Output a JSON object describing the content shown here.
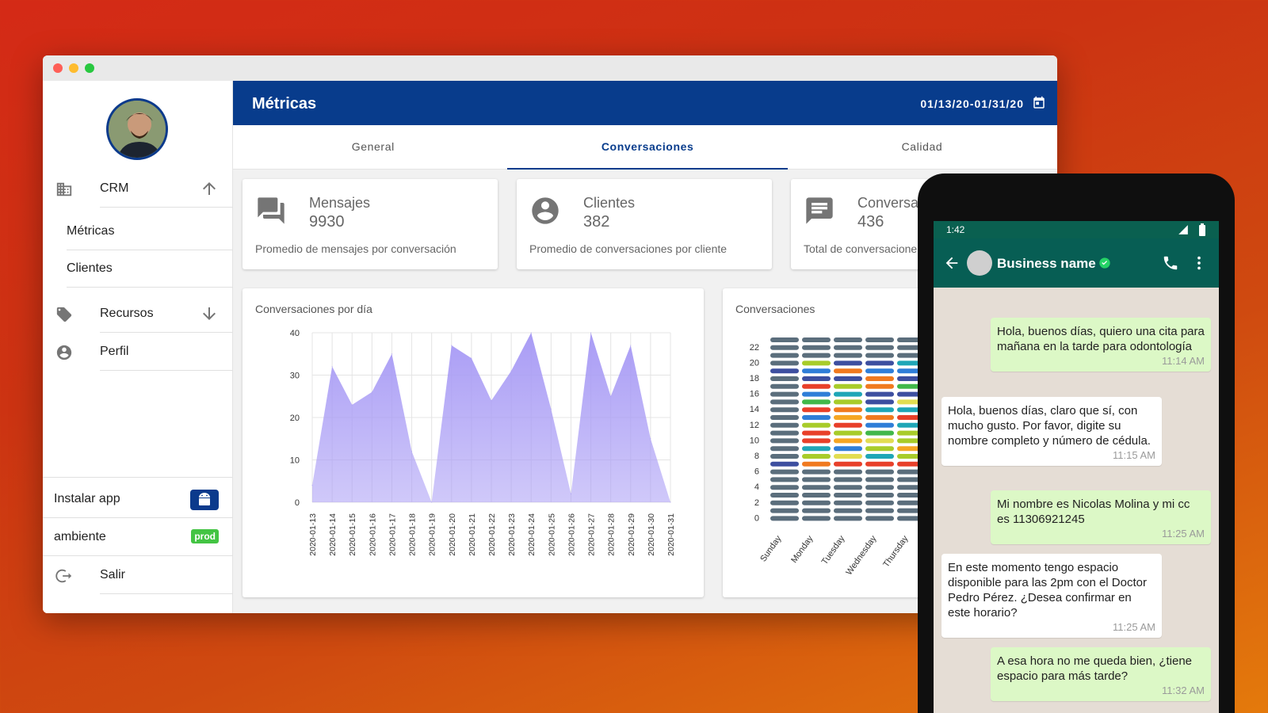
{
  "sidebar": {
    "crm_label": "CRM",
    "sub_items": [
      "Métricas",
      "Clientes"
    ],
    "recursos_label": "Recursos",
    "perfil_label": "Perfil",
    "install_label": "Instalar app",
    "env_label": "ambiente",
    "env_badge": "prod",
    "logout_label": "Salir"
  },
  "header": {
    "title": "Métricas",
    "date_range": "01/13/20-01/31/20"
  },
  "tabs": [
    "General",
    "Conversaciones",
    "Calidad"
  ],
  "stats": [
    {
      "name": "Mensajes",
      "value": "9930",
      "desc": "Promedio de mensajes por conversación",
      "icon": "forum-icon"
    },
    {
      "name": "Clientes",
      "value": "382",
      "desc": "Promedio de conversaciones por cliente",
      "icon": "account-circle-icon"
    },
    {
      "name": "Conversa",
      "value": "436",
      "desc": "Total de conversacione",
      "icon": "chat-icon"
    }
  ],
  "area_chart_title": "Conversaciones por día",
  "heatmap_title": "Conversaciones",
  "chart_data": [
    {
      "type": "area",
      "title": "Conversaciones por día",
      "categories": [
        "2020-01-13",
        "2020-01-14",
        "2020-01-15",
        "2020-01-16",
        "2020-01-17",
        "2020-01-18",
        "2020-01-19",
        "2020-01-20",
        "2020-01-21",
        "2020-01-22",
        "2020-01-23",
        "2020-01-24",
        "2020-01-25",
        "2020-01-26",
        "2020-01-27",
        "2020-01-28",
        "2020-01-29",
        "2020-01-30",
        "2020-01-31"
      ],
      "values": [
        4,
        32,
        23,
        26,
        35,
        12,
        0,
        37,
        34,
        24,
        31,
        40,
        22,
        2,
        40,
        25,
        37,
        15,
        0
      ],
      "ylim": [
        0,
        40
      ],
      "yticks": [
        0,
        10,
        20,
        30,
        40
      ],
      "color": "#a99cf5",
      "grid": true
    },
    {
      "type": "heatmap",
      "title": "Conversaciones",
      "x_categories": [
        "Sunday",
        "Monday",
        "Tuesday",
        "Wednesday",
        "Thursday"
      ],
      "y_tick_labels": [
        "0",
        "2",
        "4",
        "6",
        "8",
        "10",
        "12",
        "14",
        "16",
        "18",
        "20",
        "22"
      ],
      "rows": 24,
      "color_scale": [
        "#5b6e7c",
        "#3d4fa0",
        "#2f7ed8",
        "#1fa6b7",
        "#41b84a",
        "#a8cc2a",
        "#e2dd52",
        "#f5a623",
        "#f07a1f",
        "#e8402a"
      ]
    }
  ],
  "phone": {
    "time": "1:42",
    "business_name": "Business name",
    "messages": [
      {
        "dir": "out",
        "text": "Hola, buenos días, quiero una cita para mañana en la tarde para odontología",
        "time": "11:14 AM"
      },
      {
        "dir": "in",
        "text": "Hola, buenos días, claro que sí, con mucho gusto. Por favor, digite su nombre completo y número de cédula.",
        "time": "11:15 AM"
      },
      {
        "dir": "out",
        "text": "Mi nombre es Nicolas Molina y mi cc es 11306921245",
        "time": "11:25 AM"
      },
      {
        "dir": "in",
        "text": "En este momento tengo espacio disponible para las 2pm con el Doctor Pedro Pérez. ¿Desea confirmar en este horario?",
        "time": "11:25 AM"
      },
      {
        "dir": "out",
        "text": "A esa hora no me queda bien, ¿tiene espacio para más tarde?",
        "time": "11:32 AM"
      }
    ]
  }
}
